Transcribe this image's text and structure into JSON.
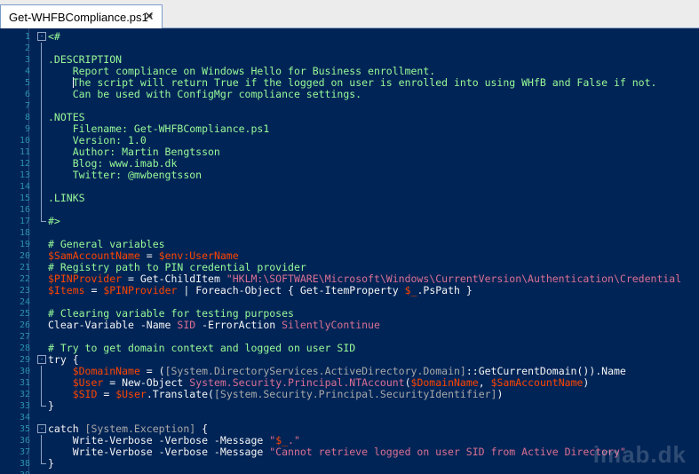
{
  "tab": {
    "title": "Get-WHFBCompliance.ps1*",
    "close_symbol": "✕"
  },
  "editor": {
    "lines": [
      {
        "n": "1",
        "fold": "-",
        "segs": [
          {
            "c": "t-c",
            "t": "<#"
          }
        ]
      },
      {
        "n": "2",
        "bar": true,
        "segs": []
      },
      {
        "n": "3",
        "bar": true,
        "segs": [
          {
            "c": "t-c",
            "t": ".DESCRIPTION"
          }
        ]
      },
      {
        "n": "4",
        "bar": true,
        "segs": [
          {
            "c": "t-c",
            "t": "    Report compliance on Windows Hello for Business enrollment."
          }
        ]
      },
      {
        "n": "5",
        "bar": true,
        "caret": true,
        "segs": [
          {
            "c": "t-c",
            "t": "    The script will return True if the logged on user is enrolled into using WHfB and False if not."
          }
        ]
      },
      {
        "n": "6",
        "bar": true,
        "segs": [
          {
            "c": "t-c",
            "t": "    Can be used with ConfigMgr compliance settings."
          }
        ]
      },
      {
        "n": "7",
        "bar": true,
        "segs": []
      },
      {
        "n": "8",
        "bar": true,
        "segs": [
          {
            "c": "t-c",
            "t": ".NOTES"
          }
        ]
      },
      {
        "n": "9",
        "bar": true,
        "segs": [
          {
            "c": "t-c",
            "t": "    Filename: Get-WHFBCompliance.ps1"
          }
        ]
      },
      {
        "n": "10",
        "bar": true,
        "segs": [
          {
            "c": "t-c",
            "t": "    Version: 1.0"
          }
        ]
      },
      {
        "n": "11",
        "bar": true,
        "segs": [
          {
            "c": "t-c",
            "t": "    Author: Martin Bengtsson"
          }
        ]
      },
      {
        "n": "12",
        "bar": true,
        "segs": [
          {
            "c": "t-c",
            "t": "    Blog: www.imab.dk"
          }
        ]
      },
      {
        "n": "13",
        "bar": true,
        "segs": [
          {
            "c": "t-c",
            "t": "    Twitter: @mwbengtsson"
          }
        ]
      },
      {
        "n": "14",
        "bar": true,
        "segs": []
      },
      {
        "n": "15",
        "bar": true,
        "segs": [
          {
            "c": "t-c",
            "t": ".LINKS"
          }
        ]
      },
      {
        "n": "16",
        "bar": true,
        "segs": []
      },
      {
        "n": "17",
        "barend": true,
        "segs": [
          {
            "c": "t-c",
            "t": "#>"
          }
        ]
      },
      {
        "n": "18",
        "segs": []
      },
      {
        "n": "19",
        "segs": [
          {
            "c": "t-c",
            "t": "# General variables"
          }
        ]
      },
      {
        "n": "20",
        "segs": [
          {
            "c": "t-v",
            "t": "$SamAccountName"
          },
          {
            "c": "t-w",
            "t": " = "
          },
          {
            "c": "t-v",
            "t": "$env:UserName"
          }
        ]
      },
      {
        "n": "21",
        "segs": [
          {
            "c": "t-c",
            "t": "# Registry path to PIN credential provider"
          }
        ]
      },
      {
        "n": "22",
        "segs": [
          {
            "c": "t-v",
            "t": "$PINProvider"
          },
          {
            "c": "t-w",
            "t": " = Get-ChildItem "
          },
          {
            "c": "t-s",
            "t": "\"HKLM:\\SOFTWARE\\Microsoft\\Windows\\CurrentVersion\\Authentication\\Credential"
          }
        ]
      },
      {
        "n": "23",
        "segs": [
          {
            "c": "t-v",
            "t": "$Items"
          },
          {
            "c": "t-w",
            "t": " = "
          },
          {
            "c": "t-v",
            "t": "$PINProvider"
          },
          {
            "c": "t-w",
            "t": " | Foreach-Object { Get-ItemProperty "
          },
          {
            "c": "t-v",
            "t": "$_"
          },
          {
            "c": "t-w",
            "t": ".PsPath }"
          }
        ]
      },
      {
        "n": "24",
        "segs": []
      },
      {
        "n": "25",
        "segs": [
          {
            "c": "t-c",
            "t": "# Clearing variable for testing purposes"
          }
        ]
      },
      {
        "n": "26",
        "segs": [
          {
            "c": "t-w",
            "t": "Clear-Variable -Name "
          },
          {
            "c": "t-s",
            "t": "SID"
          },
          {
            "c": "t-w",
            "t": " -ErrorAction "
          },
          {
            "c": "t-s",
            "t": "SilentlyContinue"
          }
        ]
      },
      {
        "n": "27",
        "segs": []
      },
      {
        "n": "28",
        "segs": [
          {
            "c": "t-c",
            "t": "# Try to get domain context and logged on user SID"
          }
        ]
      },
      {
        "n": "29",
        "fold": "-",
        "segs": [
          {
            "c": "t-w",
            "t": "try {"
          }
        ]
      },
      {
        "n": "30",
        "bar": true,
        "segs": [
          {
            "c": "t-w",
            "t": "    "
          },
          {
            "c": "t-v",
            "t": "$DomainName"
          },
          {
            "c": "t-w",
            "t": " = ("
          },
          {
            "c": "t-t",
            "t": "[System.DirectoryServices.ActiveDirectory.Domain]"
          },
          {
            "c": "t-w",
            "t": "::GetCurrentDomain()).Name"
          }
        ]
      },
      {
        "n": "31",
        "bar": true,
        "segs": [
          {
            "c": "t-w",
            "t": "    "
          },
          {
            "c": "t-v",
            "t": "$User"
          },
          {
            "c": "t-w",
            "t": " = New-Object "
          },
          {
            "c": "t-s",
            "t": "System.Security.Principal.NTAccount"
          },
          {
            "c": "t-w",
            "t": "("
          },
          {
            "c": "t-v",
            "t": "$DomainName"
          },
          {
            "c": "t-w",
            "t": ", "
          },
          {
            "c": "t-v",
            "t": "$SamAccountName"
          },
          {
            "c": "t-w",
            "t": ")"
          }
        ]
      },
      {
        "n": "32",
        "bar": true,
        "segs": [
          {
            "c": "t-w",
            "t": "    "
          },
          {
            "c": "t-v",
            "t": "$SID"
          },
          {
            "c": "t-w",
            "t": " = "
          },
          {
            "c": "t-v",
            "t": "$User"
          },
          {
            "c": "t-w",
            "t": ".Translate("
          },
          {
            "c": "t-t",
            "t": "[System.Security.Principal.SecurityIdentifier]"
          },
          {
            "c": "t-w",
            "t": ")"
          }
        ]
      },
      {
        "n": "33",
        "barend": true,
        "segs": [
          {
            "c": "t-w",
            "t": "}"
          }
        ]
      },
      {
        "n": "34",
        "segs": []
      },
      {
        "n": "35",
        "fold": "-",
        "segs": [
          {
            "c": "t-w",
            "t": "catch "
          },
          {
            "c": "t-t",
            "t": "[System.Exception]"
          },
          {
            "c": "t-w",
            "t": " {"
          }
        ]
      },
      {
        "n": "36",
        "bar": true,
        "segs": [
          {
            "c": "t-w",
            "t": "    Write-Verbose -Verbose -Message "
          },
          {
            "c": "t-s",
            "t": "\""
          },
          {
            "c": "t-v",
            "t": "$_"
          },
          {
            "c": "t-s",
            "t": ".\""
          }
        ]
      },
      {
        "n": "37",
        "bar": true,
        "segs": [
          {
            "c": "t-w",
            "t": "    Write-Verbose -Verbose -Message "
          },
          {
            "c": "t-s",
            "t": "\"Cannot retrieve logged on user SID from Active Directory\""
          }
        ]
      },
      {
        "n": "38",
        "barend": true,
        "segs": [
          {
            "c": "t-w",
            "t": "}"
          }
        ]
      },
      {
        "n": "39",
        "segs": []
      }
    ]
  },
  "watermark": "imab.dk",
  "colors": {
    "background": "#012456",
    "comment": "#98fb98",
    "variable": "#ff4500",
    "string": "#db7093",
    "type": "#a9a9a9"
  }
}
